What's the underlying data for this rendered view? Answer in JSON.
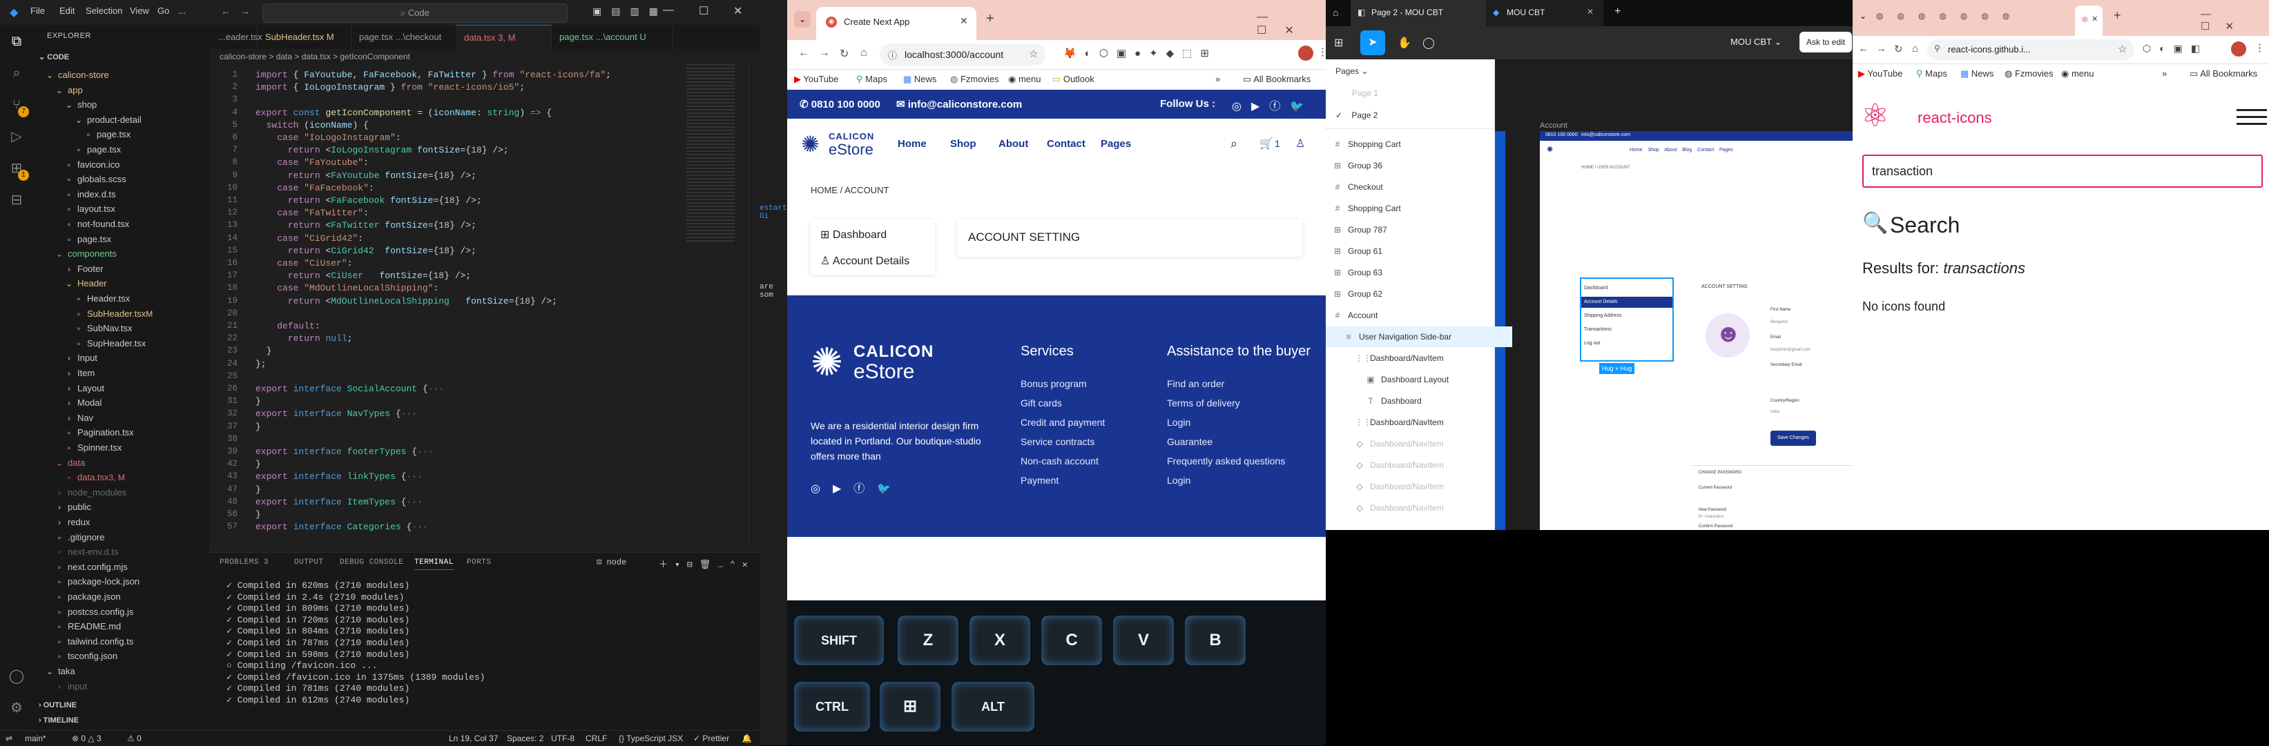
{
  "vscode": {
    "menu": [
      "File",
      "Edit",
      "Selection",
      "View",
      "Go",
      "..."
    ],
    "command_center": "Code",
    "explorer_title": "EXPLORER",
    "project_root": "CODE",
    "tree": [
      {
        "label": "calicon-store",
        "depth": 0,
        "type": "folder-open",
        "color": "#e2c08d",
        "badge": "",
        "badge_color": "#e06c75"
      },
      {
        "label": "app",
        "depth": 1,
        "type": "folder-open",
        "color": "#e2c08d",
        "badge": "",
        "badge_color": "#e06c75"
      },
      {
        "label": "shop",
        "depth": 2,
        "type": "folder-open",
        "color": "#cccccc",
        "badge": "",
        "badge_color": ""
      },
      {
        "label": "product-detail",
        "depth": 3,
        "type": "folder-open",
        "color": "#cccccc",
        "badge": "",
        "badge_color": ""
      },
      {
        "label": "page.tsx",
        "depth": 4,
        "type": "file",
        "color": "#cccccc",
        "badge": "",
        "badge_color": ""
      },
      {
        "label": "page.tsx",
        "depth": 3,
        "type": "file",
        "color": "#cccccc",
        "badge": "",
        "badge_color": ""
      },
      {
        "label": "favicon.ico",
        "depth": 2,
        "type": "file",
        "color": "#cccccc",
        "badge": "",
        "badge_color": ""
      },
      {
        "label": "globals.scss",
        "depth": 2,
        "type": "file",
        "color": "#cccccc",
        "badge": "",
        "badge_color": ""
      },
      {
        "label": "index.d.ts",
        "depth": 2,
        "type": "file",
        "color": "#cccccc",
        "badge": "",
        "badge_color": ""
      },
      {
        "label": "layout.tsx",
        "depth": 2,
        "type": "file",
        "color": "#cccccc",
        "badge": "",
        "badge_color": ""
      },
      {
        "label": "not-found.tsx",
        "depth": 2,
        "type": "file",
        "color": "#cccccc",
        "badge": "",
        "badge_color": ""
      },
      {
        "label": "page.tsx",
        "depth": 2,
        "type": "file",
        "color": "#cccccc",
        "badge": "",
        "badge_color": ""
      },
      {
        "label": "components",
        "depth": 1,
        "type": "folder-open",
        "color": "#73c991",
        "badge": "",
        "badge_color": "#73c991"
      },
      {
        "label": "Footer",
        "depth": 2,
        "type": "folder",
        "color": "#cccccc",
        "badge": "",
        "badge_color": ""
      },
      {
        "label": "Header",
        "depth": 2,
        "type": "folder-open",
        "color": "#e2c08d",
        "badge": "",
        "badge_color": "#e2c08d"
      },
      {
        "label": "Header.tsx",
        "depth": 3,
        "type": "file",
        "color": "#cccccc",
        "badge": "",
        "badge_color": ""
      },
      {
        "label": "SubHeader.tsx",
        "depth": 3,
        "type": "file",
        "color": "#e2c08d",
        "badge": "M",
        "badge_color": "#e2c08d"
      },
      {
        "label": "SubNav.tsx",
        "depth": 3,
        "type": "file",
        "color": "#cccccc",
        "badge": "",
        "badge_color": ""
      },
      {
        "label": "SupHeader.tsx",
        "depth": 3,
        "type": "file",
        "color": "#cccccc",
        "badge": "",
        "badge_color": ""
      },
      {
        "label": "Input",
        "depth": 2,
        "type": "folder",
        "color": "#cccccc",
        "badge": "",
        "badge_color": ""
      },
      {
        "label": "Item",
        "depth": 2,
        "type": "folder",
        "color": "#cccccc",
        "badge": "",
        "badge_color": ""
      },
      {
        "label": "Layout",
        "depth": 2,
        "type": "folder",
        "color": "#cccccc",
        "badge": "",
        "badge_color": ""
      },
      {
        "label": "Modal",
        "depth": 2,
        "type": "folder",
        "color": "#cccccc",
        "badge": "",
        "badge_color": ""
      },
      {
        "label": "Nav",
        "depth": 2,
        "type": "folder",
        "color": "#cccccc",
        "badge": "",
        "badge_color": ""
      },
      {
        "label": "Pagination.tsx",
        "depth": 2,
        "type": "file",
        "color": "#cccccc",
        "badge": "",
        "badge_color": ""
      },
      {
        "label": "Spinner.tsx",
        "depth": 2,
        "type": "file",
        "color": "#cccccc",
        "badge": "",
        "badge_color": ""
      },
      {
        "label": "data",
        "depth": 1,
        "type": "folder-open",
        "color": "#e06c75",
        "badge": "",
        "badge_color": "#e06c75"
      },
      {
        "label": "data.tsx",
        "depth": 2,
        "type": "file",
        "color": "#e06c75",
        "badge": "3, M",
        "badge_color": "#e06c75"
      },
      {
        "label": "node_modules",
        "depth": 1,
        "type": "folder",
        "color": "#6b6b6b",
        "badge": "",
        "badge_color": ""
      },
      {
        "label": "public",
        "depth": 1,
        "type": "folder",
        "color": "#cccccc",
        "badge": "",
        "badge_color": ""
      },
      {
        "label": "redux",
        "depth": 1,
        "type": "folder",
        "color": "#cccccc",
        "badge": "",
        "badge_color": ""
      },
      {
        "label": ".gitignore",
        "depth": 1,
        "type": "file",
        "color": "#cccccc",
        "badge": "",
        "badge_color": ""
      },
      {
        "label": "next-env.d.ts",
        "depth": 1,
        "type": "file",
        "color": "#6b6b6b",
        "badge": "",
        "badge_color": ""
      },
      {
        "label": "next.config.mjs",
        "depth": 1,
        "type": "file",
        "color": "#cccccc",
        "badge": "",
        "badge_color": ""
      },
      {
        "label": "package-lock.json",
        "depth": 1,
        "type": "file",
        "color": "#cccccc",
        "badge": "",
        "badge_color": ""
      },
      {
        "label": "package.json",
        "depth": 1,
        "type": "file",
        "color": "#cccccc",
        "badge": "",
        "badge_color": ""
      },
      {
        "label": "postcss.config.js",
        "depth": 1,
        "type": "file",
        "color": "#cccccc",
        "badge": "",
        "badge_color": ""
      },
      {
        "label": "README.md",
        "depth": 1,
        "type": "file",
        "color": "#cccccc",
        "badge": "",
        "badge_color": ""
      },
      {
        "label": "tailwind.config.ts",
        "depth": 1,
        "type": "file",
        "color": "#cccccc",
        "badge": "",
        "badge_color": ""
      },
      {
        "label": "tsconfig.json",
        "depth": 1,
        "type": "file",
        "color": "#cccccc",
        "badge": "",
        "badge_color": ""
      },
      {
        "label": "taka",
        "depth": 0,
        "type": "folder-open",
        "color": "#cccccc",
        "badge": "",
        "badge_color": ""
      },
      {
        "label": "input",
        "depth": 1,
        "type": "folder",
        "color": "#6b6b6b",
        "badge": "",
        "badge_color": ""
      }
    ],
    "outline_label": "OUTLINE",
    "timeline_label": "TIMELINE",
    "tabs": [
      {
        "label": "...eader.tsx",
        "active": false,
        "color": "#9d9d9d"
      },
      {
        "label": "SubHeader.tsx M",
        "active": false,
        "color": "#e2c08d"
      },
      {
        "label": "page.tsx ...\\checkout",
        "active": false,
        "color": "#9d9d9d"
      },
      {
        "label": "data.tsx 3, M",
        "active": true,
        "color": "#e06c75"
      },
      {
        "label": "page.tsx ...\\account U",
        "active": false,
        "color": "#73c991"
      }
    ],
    "breadcrumb": "calicon-store > data > data.tsx > getIconComponent",
    "editor_lines": [
      {
        "n": "1",
        "html": "<span class='kw'>import</span> { <span class='vr'>FaYoutube</span>, <span class='vr'>FaFacebook</span>, <span class='vr'>FaTwitter</span> } <span class='kw'>from</span> <span class='str'>\"react-icons/fa\"</span>;"
      },
      {
        "n": "2",
        "html": "<span class='kw'>import</span> { <span class='vr'>IoLogoInstagram</span> } <span class='kw'>from</span> <span class='str'>\"react-icons/io5\"</span>;"
      },
      {
        "n": "3",
        "html": ""
      },
      {
        "n": "4",
        "html": "<span class='kw'>export</span> <span class='kb'>const</span> <span class='fn'>getIconComponent</span> = (<span class='vr'>iconName</span>: <span class='tp'>string</span>) <span class='kb'>=&gt;</span> {"
      },
      {
        "n": "5",
        "html": "  <span class='kw'>switch</span> (<span class='vr'>iconName</span>) {"
      },
      {
        "n": "6",
        "html": "    <span class='kw'>case</span> <span class='str'>\"IoLogoInstagram\"</span>:"
      },
      {
        "n": "7",
        "html": "      <span class='kw'>return</span> &lt;<span class='tg'>IoLogoInstagram</span> <span class='vr'>fontSize</span>={<span class='nm'>18</span>} /&gt;;"
      },
      {
        "n": "8",
        "html": "    <span class='kw'>case</span> <span class='str'>\"FaYoutube\"</span>:"
      },
      {
        "n": "9",
        "html": "      <span class='kw'>return</span> &lt;<span class='tg'>FaYoutube</span> <span class='vr'>fontSize</span>={<span class='nm'>18</span>} /&gt;;"
      },
      {
        "n": "10",
        "html": "    <span class='kw'>case</span> <span class='str'>\"FaFacebook\"</span>:"
      },
      {
        "n": "11",
        "html": "      <span class='kw'>return</span> &lt;<span class='tg'>FaFacebook</span> <span class='vr'>fontSize</span>={<span class='nm'>18</span>} /&gt;;"
      },
      {
        "n": "12",
        "html": "    <span class='kw'>case</span> <span class='str'>\"FaTwitter\"</span>:"
      },
      {
        "n": "13",
        "html": "      <span class='kw'>return</span> &lt;<span class='tg'>FaTwitter</span> <span class='vr'>fontSize</span>={<span class='nm'>18</span>} /&gt;;"
      },
      {
        "n": "14",
        "html": "    <span class='kw'>case</span> <span class='str'>\"CiGrid42\"</span>:"
      },
      {
        "n": "15",
        "html": "      <span class='kw'>return</span> &lt;<span class='tg'>CiGrid42</span>  <span class='vr'>fontSize</span>={<span class='nm'>18</span>} /&gt;;"
      },
      {
        "n": "16",
        "html": "    <span class='kw'>case</span> <span class='str'>\"CiUser\"</span>:"
      },
      {
        "n": "17",
        "html": "      <span class='kw'>return</span> &lt;<span class='tg'>CiUser</span>   <span class='vr'>fontSize</span>={<span class='nm'>18</span>} /&gt;;"
      },
      {
        "n": "18",
        "html": "    <span class='kw'>case</span> <span class='str'>\"MdOutlineLocalShipping\"</span>:"
      },
      {
        "n": "19",
        "html": "      <span class='kw'>return</span> &lt;<span class='tg'>MdOutlineLocalShipping</span>   <span class='vr'>fontSize</span>={<span class='nm'>18</span>} /&gt;;"
      },
      {
        "n": "20",
        "html": ""
      },
      {
        "n": "21",
        "html": "    <span class='kw'>default</span>:"
      },
      {
        "n": "22",
        "html": "      <span class='kw'>return</span> <span class='kb'>null</span>;"
      },
      {
        "n": "23",
        "html": "  }"
      },
      {
        "n": "24",
        "html": "};"
      },
      {
        "n": "25",
        "html": ""
      },
      {
        "n": "26",
        "html": "<span class='kw'>export</span> <span class='kb'>interface</span> <span class='tp'>SocialAccount</span> {<span style='color:#6e7681'>···</span>"
      },
      {
        "n": "31",
        "html": "}"
      },
      {
        "n": "32",
        "html": "<span class='kw'>export</span> <span class='kb'>interface</span> <span class='tp'>NavTypes</span> {<span style='color:#6e7681'>···</span>"
      },
      {
        "n": "37",
        "html": "}"
      },
      {
        "n": "38",
        "html": ""
      },
      {
        "n": "39",
        "html": "<span class='kw'>export</span> <span class='kb'>interface</span> <span class='tp'>footerTypes</span> {<span style='color:#6e7681'>···</span>"
      },
      {
        "n": "42",
        "html": "}"
      },
      {
        "n": "43",
        "html": "<span class='kw'>export</span> <span class='kb'>interface</span> <span class='tp'>linkTypes</span> {<span style='color:#6e7681'>···</span>"
      },
      {
        "n": "47",
        "html": "}"
      },
      {
        "n": "48",
        "html": "<span class='kw'>export</span> <span class='kb'>interface</span> <span class='tp'>ItemTypes</span> {<span style='color:#6e7681'>···</span>"
      },
      {
        "n": "56",
        "html": "}"
      },
      {
        "n": "57",
        "html": "<span class='kw'>export</span> <span class='kb'>interface</span> <span class='tp'>Categories</span> {<span style='color:#6e7681'>···</span>"
      }
    ],
    "panel_tabs": [
      "PROBLEMS 3",
      "OUTPUT",
      "DEBUG CONSOLE",
      "TERMINAL",
      "PORTS"
    ],
    "panel_active": "TERMINAL",
    "terminal_shell": "node",
    "terminal_lines": [
      "✓ Compiled in 620ms (2710 modules)",
      "✓ Compiled in 2.4s (2710 modules)",
      "✓ Compiled in 809ms (2710 modules)",
      "✓ Compiled in 720ms (2710 modules)",
      "✓ Compiled in 804ms (2710 modules)",
      "✓ Compiled in 787ms (2710 modules)",
      "✓ Compiled in 598ms (2710 modules)",
      "○ Compiling /favicon.ico ...",
      "✓ Compiled /favicon.ico in 1375ms (1389 modules)",
      "✓ Compiled in 781ms (2740 modules)",
      "✓ Compiled in 612ms (2740 modules)"
    ],
    "status": {
      "branch": "main*",
      "errors": "⊗ 0  △ 3",
      "warnings": "⚠ 0",
      "position": "Ln 19, Col 37",
      "spaces": "Spaces: 2",
      "encoding": "UTF-8",
      "eol": "CRLF",
      "language": "{} TypeScript JSX",
      "formatter": "✓ Prettier"
    }
  },
  "chrome1": {
    "tab_title": "Create Next App",
    "url": "localhost:3000/account",
    "bookmarks": [
      "YouTube",
      "Maps",
      "News",
      "Fzmovies",
      "menu",
      "Outlook"
    ],
    "all_bookmarks": "All Bookmarks"
  },
  "site": {
    "phone": "0810 100 0000",
    "email": "info@caliconstore.com",
    "follow_us": "Follow Us :",
    "logo_top": "CALICON",
    "logo_bottom": "eStore",
    "nav": [
      "Home",
      "Shop",
      "About",
      "Contact",
      "Pages"
    ],
    "cart_count": "1",
    "breadcrumb": "HOME / ACCOUNT",
    "sidebar": [
      "Dashboard",
      "Account Details"
    ],
    "main_heading": "ACCOUNT SETTING",
    "footer_logo_top": "CALICON",
    "footer_logo_bottom": "eStore",
    "footer_about": "We are a residential interior design firm located in Portland. Our boutique-studio offers more than",
    "services_title": "Services",
    "services": [
      "Bonus program",
      "Gift cards",
      "Credit and payment",
      "Service contracts",
      "Non-cash account",
      "Payment"
    ],
    "assist_title": "Assistance to the buyer",
    "assist": [
      "Find an order",
      "Terms of delivery",
      "Login",
      "Guarantee",
      "Frequently asked questions",
      "Login"
    ],
    "brand_color": "#1a3591"
  },
  "keyboard": {
    "row1": [
      "SHIFT",
      "Z",
      "X",
      "C",
      "V",
      "B"
    ],
    "row2": [
      "CTRL",
      "⊞",
      "ALT"
    ]
  },
  "figma": {
    "tab1": "Page 2 - MOU CBT",
    "tab2": "MOU CBT",
    "file_name": "MOU CBT",
    "ask_to_edit": "Ask to edit",
    "pages_label": "Pages",
    "pages": [
      "Page 1",
      "Page 2"
    ],
    "layers": [
      {
        "label": "Shopping Cart",
        "indent": 0,
        "icon": "#",
        "faded": false,
        "selected": false
      },
      {
        "label": "Group 36",
        "indent": 0,
        "icon": "⊞",
        "faded": false,
        "selected": false
      },
      {
        "label": "Checkout",
        "indent": 0,
        "icon": "#",
        "faded": false,
        "selected": false
      },
      {
        "label": "Shopping Cart",
        "indent": 0,
        "icon": "#",
        "faded": false,
        "selected": false
      },
      {
        "label": "Group 787",
        "indent": 0,
        "icon": "⊞",
        "faded": false,
        "selected": false
      },
      {
        "label": "Group 61",
        "indent": 0,
        "icon": "⊞",
        "faded": false,
        "selected": false
      },
      {
        "label": "Group 63",
        "indent": 0,
        "icon": "⊞",
        "faded": false,
        "selected": false
      },
      {
        "label": "Group 62",
        "indent": 0,
        "icon": "⊞",
        "faded": false,
        "selected": false
      },
      {
        "label": "Account",
        "indent": 0,
        "icon": "#",
        "faded": false,
        "selected": false
      },
      {
        "label": "User Navigation Side-bar",
        "indent": 1,
        "icon": "≡",
        "faded": false,
        "selected": true
      },
      {
        "label": "Dashboard/NavItem",
        "indent": 2,
        "icon": "⋮⋮",
        "faded": false,
        "selected": false
      },
      {
        "label": "Dashboard Layout",
        "indent": 3,
        "icon": "▣",
        "faded": false,
        "selected": false
      },
      {
        "label": "Dashboard",
        "indent": 3,
        "icon": "T",
        "faded": false,
        "selected": false
      },
      {
        "label": "Dashboard/NavItem",
        "indent": 2,
        "icon": "⋮⋮",
        "faded": false,
        "selected": false
      },
      {
        "label": "Dashboard/NavItem",
        "indent": 2,
        "icon": "◇",
        "faded": true,
        "selected": false
      },
      {
        "label": "Dashboard/NavItem",
        "indent": 2,
        "icon": "◇",
        "faded": true,
        "selected": false
      },
      {
        "label": "Dashboard/NavItem",
        "indent": 2,
        "icon": "◇",
        "faded": true,
        "selected": false
      },
      {
        "label": "Dashboard/NavItem",
        "indent": 2,
        "icon": "◇",
        "faded": true,
        "selected": false
      }
    ],
    "frame_label": "Account",
    "mock_phone": "0810 100 0000",
    "mock_email": "info@caliconstore.com",
    "mock_nav": [
      "Home",
      "Shop",
      "About",
      "Blog",
      "Contact",
      "Pages"
    ],
    "mock_bread": "HOME / USER ACCOUNT",
    "mock_sidebar": [
      "Dashboard",
      "Account Details",
      "Shipping Address",
      "Transactions",
      "Log out"
    ],
    "mock_heading": "ACCOUNT SETTING",
    "mock_fields": [
      "First Name",
      "Email",
      "Secondary Email",
      "Country/Region",
      "Current Password",
      "New Password",
      "Confirm Password"
    ],
    "mock_values": [
      "Benjamin",
      "benjamin@gmail.com",
      "India",
      "8+ characters"
    ],
    "mock_button": "Save Changes",
    "mock_change_pw": "CHANGE PASSWORD",
    "hug_label": "Hug × Hug"
  },
  "chrome3": {
    "url": "react-icons.github.i...",
    "bookmarks": [
      "YouTube",
      "Maps",
      "News",
      "Fzmovies",
      "menu"
    ],
    "all_bookmarks": "All Bookmarks",
    "brand": "react-icons",
    "search_value": "transaction",
    "search_heading": "Search",
    "results_prefix": "Results for: ",
    "results_term": "transactions",
    "no_results": "No icons found",
    "accent": "#e91e63"
  },
  "overlay_texts": {
    "restart": "estart Gi",
    "are_some": "are som"
  }
}
